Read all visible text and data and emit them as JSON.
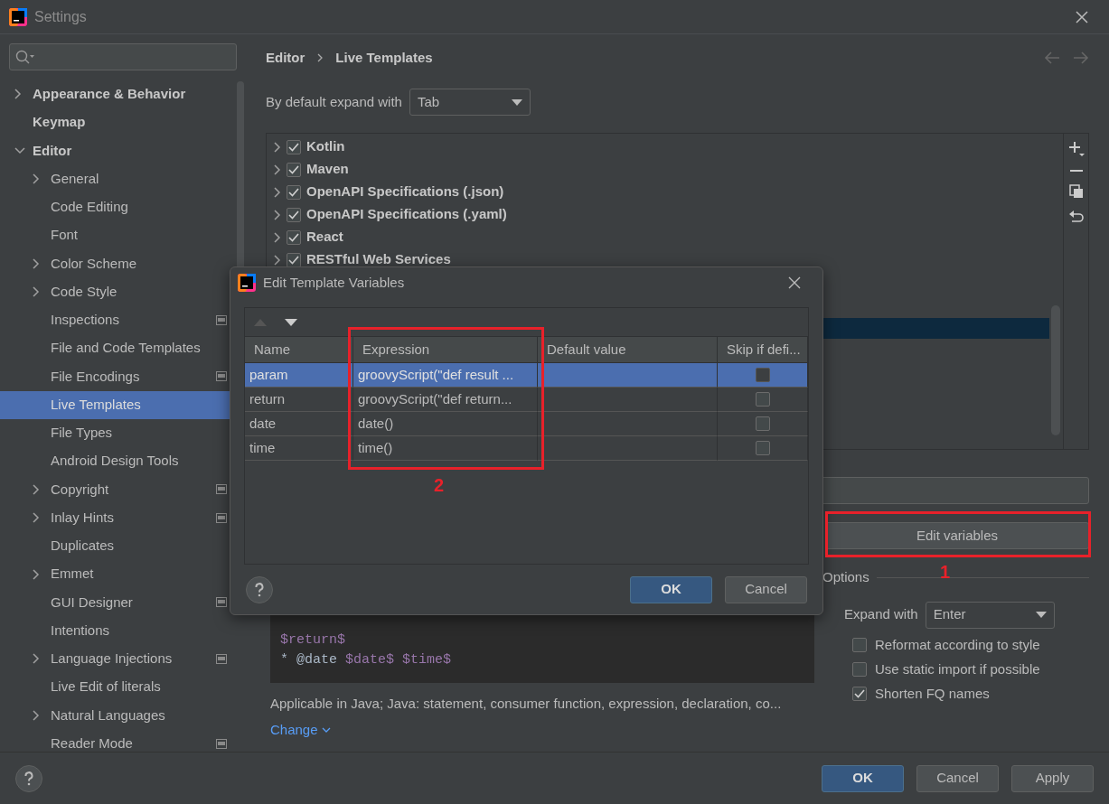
{
  "window": {
    "title": "Settings"
  },
  "sidebar": {
    "items": [
      {
        "label": "Appearance & Behavior",
        "expanded": false,
        "selected": false
      },
      {
        "label": "Keymap",
        "selected": false
      },
      {
        "label": "Editor",
        "expanded": true,
        "selected": false,
        "children": [
          {
            "label": "General",
            "expanded": false,
            "selected": false
          },
          {
            "label": "Code Editing",
            "selected": false
          },
          {
            "label": "Font",
            "selected": false
          },
          {
            "label": "Color Scheme",
            "expanded": false,
            "selected": false
          },
          {
            "label": "Code Style",
            "expanded": false,
            "selected": false
          },
          {
            "label": "Inspections",
            "project_icon": true,
            "selected": false
          },
          {
            "label": "File and Code Templates",
            "selected": false
          },
          {
            "label": "File Encodings",
            "project_icon": true,
            "selected": false
          },
          {
            "label": "Live Templates",
            "selected": true
          },
          {
            "label": "File Types",
            "selected": false
          },
          {
            "label": "Android Design Tools",
            "selected": false
          },
          {
            "label": "Copyright",
            "expanded": false,
            "project_icon": true,
            "selected": false
          },
          {
            "label": "Inlay Hints",
            "expanded": false,
            "project_icon": true,
            "selected": false
          },
          {
            "label": "Duplicates",
            "selected": false
          },
          {
            "label": "Emmet",
            "expanded": false,
            "selected": false
          },
          {
            "label": "GUI Designer",
            "project_icon": true,
            "selected": false
          },
          {
            "label": "Intentions",
            "selected": false
          },
          {
            "label": "Language Injections",
            "expanded": false,
            "project_icon": true,
            "selected": false
          },
          {
            "label": "Live Edit of literals",
            "selected": false
          },
          {
            "label": "Natural Languages",
            "expanded": false,
            "selected": false
          },
          {
            "label": "Reader Mode",
            "project_icon": true,
            "selected": false
          }
        ]
      }
    ]
  },
  "breadcrumb": [
    "Editor",
    "Live Templates"
  ],
  "default_expand": {
    "label": "By default expand with",
    "value": "Tab"
  },
  "templates": [
    {
      "label": "Kotlin",
      "checked": true,
      "expanded": false
    },
    {
      "label": "Maven",
      "checked": true,
      "expanded": false
    },
    {
      "label": "OpenAPI Specifications (.json)",
      "checked": true,
      "expanded": false
    },
    {
      "label": "OpenAPI Specifications (.yaml)",
      "checked": true,
      "expanded": false
    },
    {
      "label": "React",
      "checked": true,
      "expanded": false
    },
    {
      "label": "RESTful Web Services",
      "checked": true,
      "expanded": false
    }
  ],
  "edit_variables_button": "Edit variables",
  "code_lines": [
    [
      {
        "kind": "variable",
        "text": "$return$"
      }
    ],
    [
      {
        "kind": "plain",
        "text": "* @date "
      },
      {
        "kind": "variable",
        "text": "$date$ $time$"
      }
    ]
  ],
  "applicable_text": "Applicable in Java; Java: statement, consumer function, expression, declaration, co...",
  "change_link": "Change",
  "options": {
    "title": "Options",
    "expand_with": {
      "label": "Expand with",
      "value": "Enter"
    },
    "checkboxes": [
      {
        "label": "Reformat according to style",
        "checked": false
      },
      {
        "label": "Use static import if possible",
        "checked": false
      },
      {
        "label": "Shorten FQ names",
        "checked": true
      }
    ]
  },
  "footer_buttons": [
    {
      "label": "OK",
      "kind": "primary"
    },
    {
      "label": "Cancel",
      "kind": "normal"
    },
    {
      "label": "Apply",
      "kind": "normal"
    }
  ],
  "dialog": {
    "title": "Edit Template Variables",
    "columns": [
      "Name",
      "Expression",
      "Default value",
      "Skip if defi..."
    ],
    "rows": [
      {
        "name": "param",
        "expression": "groovyScript(\"def result ...",
        "skip_if_defined": false,
        "selected": true
      },
      {
        "name": "return",
        "expression": "groovyScript(\"def return...",
        "skip_if_defined": false,
        "selected": false
      },
      {
        "name": "date",
        "expression": "date()",
        "skip_if_defined": false,
        "selected": false
      },
      {
        "name": "time",
        "expression": "time()",
        "skip_if_defined": false,
        "selected": false
      }
    ],
    "buttons": [
      {
        "label": "OK",
        "kind": "primary"
      },
      {
        "label": "Cancel",
        "kind": "normal"
      }
    ]
  },
  "annotations": [
    {
      "label": "1"
    },
    {
      "label": "2"
    }
  ]
}
